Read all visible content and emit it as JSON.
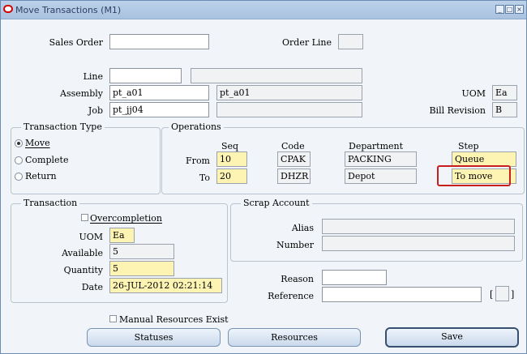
{
  "window": {
    "title": "Move Transactions (M1)",
    "controls": [
      "_",
      "□",
      "×"
    ]
  },
  "header": {
    "sales_order_label": "Sales Order",
    "sales_order_value": "",
    "order_line_label": "Order Line",
    "order_line_value": "",
    "line_label": "Line",
    "line_value": "",
    "line_desc": "",
    "assembly_label": "Assembly",
    "assembly_value": "pt_a01",
    "assembly_desc": "pt_a01",
    "job_label": "Job",
    "job_value": "pt_jj04",
    "job_desc": "",
    "uom_label": "UOM",
    "uom_value": "Ea",
    "bill_revision_label": "Bill Revision",
    "bill_revision_value": "B"
  },
  "transaction_type": {
    "title": "Transaction Type",
    "options": [
      {
        "label": "Move",
        "selected": true
      },
      {
        "label": "Complete",
        "selected": false
      },
      {
        "label": "Return",
        "selected": false
      }
    ]
  },
  "operations": {
    "title": "Operations",
    "columns": {
      "seq": "Seq",
      "code": "Code",
      "department": "Department",
      "step": "Step"
    },
    "from": {
      "label": "From",
      "seq": "10",
      "code": "CPAK",
      "department": "PACKING",
      "step": "Queue"
    },
    "to": {
      "label": "To",
      "seq": "20",
      "code": "DHZR",
      "department": "Depot",
      "step": "To move"
    }
  },
  "transaction": {
    "title": "Transaction",
    "overcompletion_label": "Overcompletion",
    "overcompletion_checked": false,
    "uom_label": "UOM",
    "uom_value": "Ea",
    "available_label": "Available",
    "available_value": "5",
    "quantity_label": "Quantity",
    "quantity_value": "5",
    "date_label": "Date",
    "date_value": "26-JUL-2012 02:21:14"
  },
  "scrap_account": {
    "title": "Scrap Account",
    "alias_label": "Alias",
    "alias_value": "",
    "number_label": "Number",
    "number_value": ""
  },
  "reason": {
    "reason_label": "Reason",
    "reason_value": "",
    "reference_label": "Reference",
    "reference_value": "",
    "dff_open": "[",
    "dff_close": "]"
  },
  "manual_resources": {
    "label": "Manual Resources Exist",
    "checked": false
  },
  "buttons": {
    "statuses": "Statuses",
    "resources": "Resources",
    "save": "Save"
  },
  "colors": {
    "required_field": "#fdf3b3",
    "highlight": "#c81e1e",
    "titlebar": "#a9c2df"
  }
}
